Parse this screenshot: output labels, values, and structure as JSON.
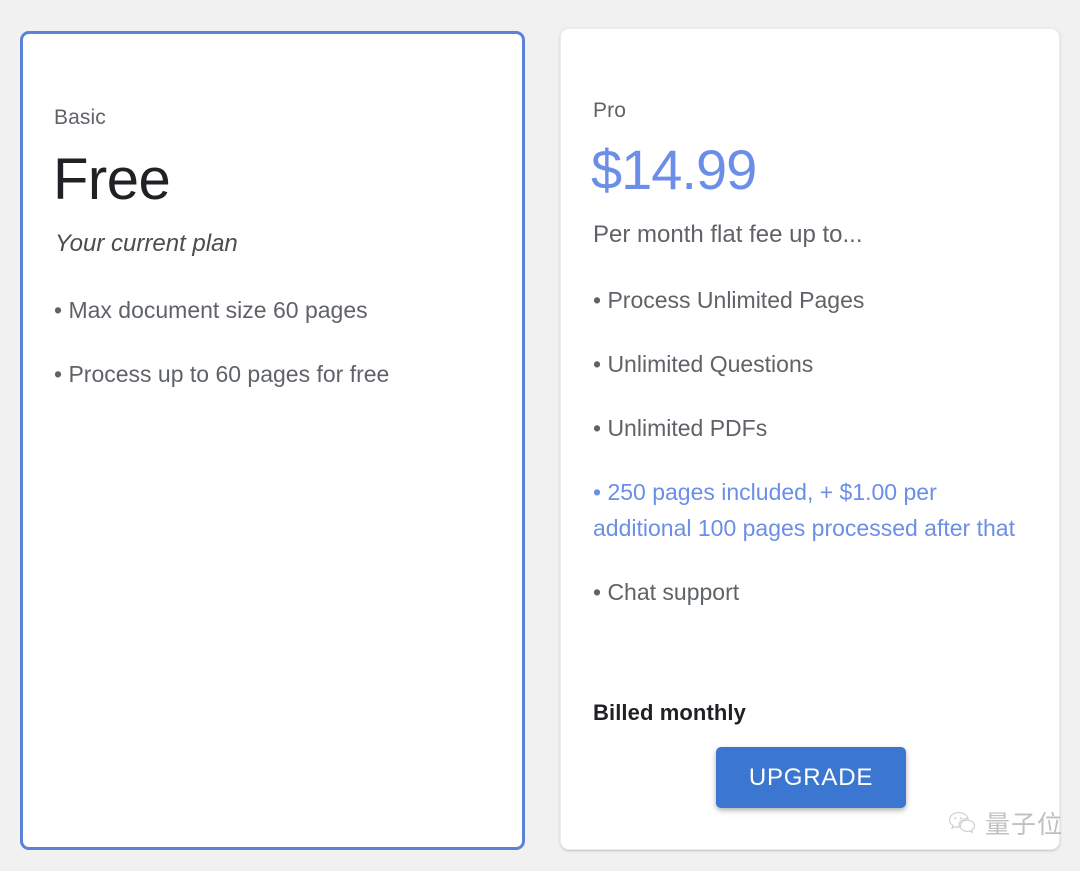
{
  "theme": {
    "page_background": "#f1f1f1",
    "card_background": "#ffffff",
    "basic_border": "#5b82d9",
    "accent_blue": "#6b8ee8",
    "button_blue": "#3b76d1",
    "text_primary": "#202124",
    "text_secondary": "#5f6368"
  },
  "plans": {
    "basic": {
      "name": "Basic",
      "price": "Free",
      "tagline": "Your current plan",
      "features": [
        "• Max document size 60 pages",
        "• Process up to 60 pages for free"
      ]
    },
    "pro": {
      "name": "Pro",
      "price": "$14.99",
      "tagline": "Per month flat fee up to...",
      "features": [
        "• Process Unlimited Pages",
        "• Unlimited Questions",
        "• Unlimited PDFs",
        "• 250 pages included, + $1.00 per additional 100 pages processed after that",
        "• Chat support"
      ],
      "billing_note": "Billed monthly",
      "cta_label": "UPGRADE"
    }
  },
  "watermark": {
    "text": "量子位",
    "icon": "wechat-icon"
  }
}
